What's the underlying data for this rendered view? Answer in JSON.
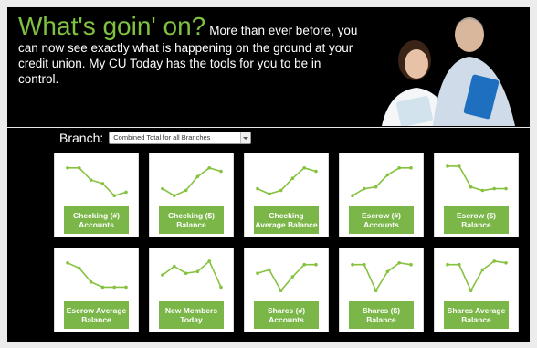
{
  "hero": {
    "headline": "What's goin' on?",
    "intro": "More than ever before, you can now see exactly what is happening on the ground at your credit union. My CU Today has the tools for you to be in control."
  },
  "branch": {
    "label": "Branch:",
    "selected": "Combined Total for all Branches"
  },
  "colors": {
    "headline": "#7fc241",
    "tile_label_bg": "#7ab648",
    "sparkline": "#86c23f"
  },
  "tiles": [
    {
      "label": "Checking (#) Accounts",
      "spark": [
        0.9,
        0.9,
        0.55,
        0.45,
        0.1,
        0.2
      ]
    },
    {
      "label": "Checking ($) Balance",
      "spark": [
        0.3,
        0.1,
        0.25,
        0.65,
        0.9,
        0.8
      ]
    },
    {
      "label": "Checking Average Balance",
      "spark": [
        0.3,
        0.15,
        0.25,
        0.6,
        0.9,
        0.8
      ]
    },
    {
      "label": "Escrow (#) Accounts",
      "spark": [
        0.1,
        0.3,
        0.35,
        0.7,
        0.9,
        0.9
      ]
    },
    {
      "label": "Escrow ($) Balance",
      "spark": [
        0.95,
        0.95,
        0.35,
        0.25,
        0.3,
        0.3
      ]
    },
    {
      "label": "Escrow Average Balance",
      "spark": [
        0.9,
        0.75,
        0.35,
        0.2,
        0.2,
        0.2
      ]
    },
    {
      "label": "New Members Today",
      "spark": [
        0.55,
        0.8,
        0.6,
        0.65,
        0.95,
        0.2
      ]
    },
    {
      "label": "Shares (#) Accounts",
      "spark": [
        0.6,
        0.7,
        0.1,
        0.5,
        0.85,
        0.85
      ]
    },
    {
      "label": "Shares ($) Balance",
      "spark": [
        0.85,
        0.85,
        0.1,
        0.65,
        0.9,
        0.85
      ]
    },
    {
      "label": "Shares Average Balance",
      "spark": [
        0.85,
        0.85,
        0.1,
        0.7,
        0.95,
        0.9
      ]
    }
  ]
}
